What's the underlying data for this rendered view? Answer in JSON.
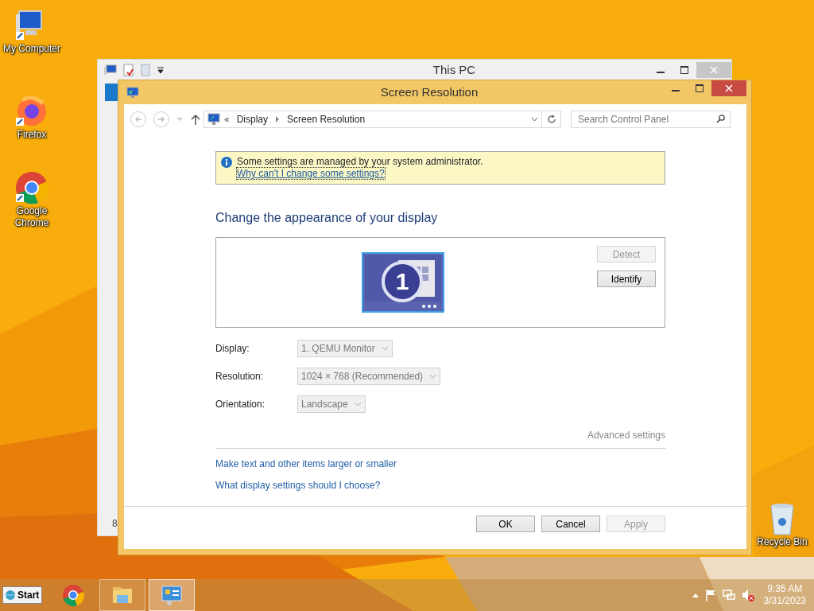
{
  "desktop_icons": [
    {
      "label": "My Computer",
      "kind": "computer"
    },
    {
      "label": "Firefox",
      "kind": "firefox"
    },
    {
      "label": "Google Chrome",
      "kind": "chrome"
    },
    {
      "label": "Recycle Bin",
      "kind": "recycle"
    }
  ],
  "background_window": {
    "title": "This PC",
    "status_text": "8"
  },
  "window": {
    "title": "Screen Resolution",
    "breadcrumb_prefix": "«",
    "breadcrumb": [
      "Display",
      "Screen Resolution"
    ],
    "search": {
      "placeholder": "Search Control Panel"
    },
    "notice": {
      "text": "Some settings are managed by your system administrator.",
      "link": "Why can't I change some settings?"
    },
    "heading": "Change the appearance of your display",
    "monitor": {
      "number": "1"
    },
    "preview_buttons": [
      {
        "label": "Detect",
        "disabled": true
      },
      {
        "label": "Identify",
        "disabled": false
      }
    ],
    "fields": [
      {
        "label": "Display:",
        "value": "1. QEMU Monitor",
        "disabled": true
      },
      {
        "label": "Resolution:",
        "value": "1024 × 768 (Recommended)",
        "disabled": true
      },
      {
        "label": "Orientation:",
        "value": "Landscape",
        "disabled": true
      }
    ],
    "advanced_link": {
      "label": "Advanced settings",
      "disabled": true
    },
    "links": [
      "Make text and other items larger or smaller",
      "What display settings should I choose?"
    ],
    "buttons": [
      {
        "label": "OK",
        "disabled": false
      },
      {
        "label": "Cancel",
        "disabled": false
      },
      {
        "label": "Apply",
        "disabled": true
      }
    ]
  },
  "taskbar": {
    "start": "Start",
    "apps": [
      {
        "kind": "chrome",
        "open": false,
        "selected": false
      },
      {
        "kind": "explorer",
        "open": true,
        "selected": false
      },
      {
        "kind": "control-panel",
        "open": true,
        "selected": true
      }
    ],
    "clock": {
      "time": "9:35 AM",
      "date": "3/31/2023"
    }
  }
}
